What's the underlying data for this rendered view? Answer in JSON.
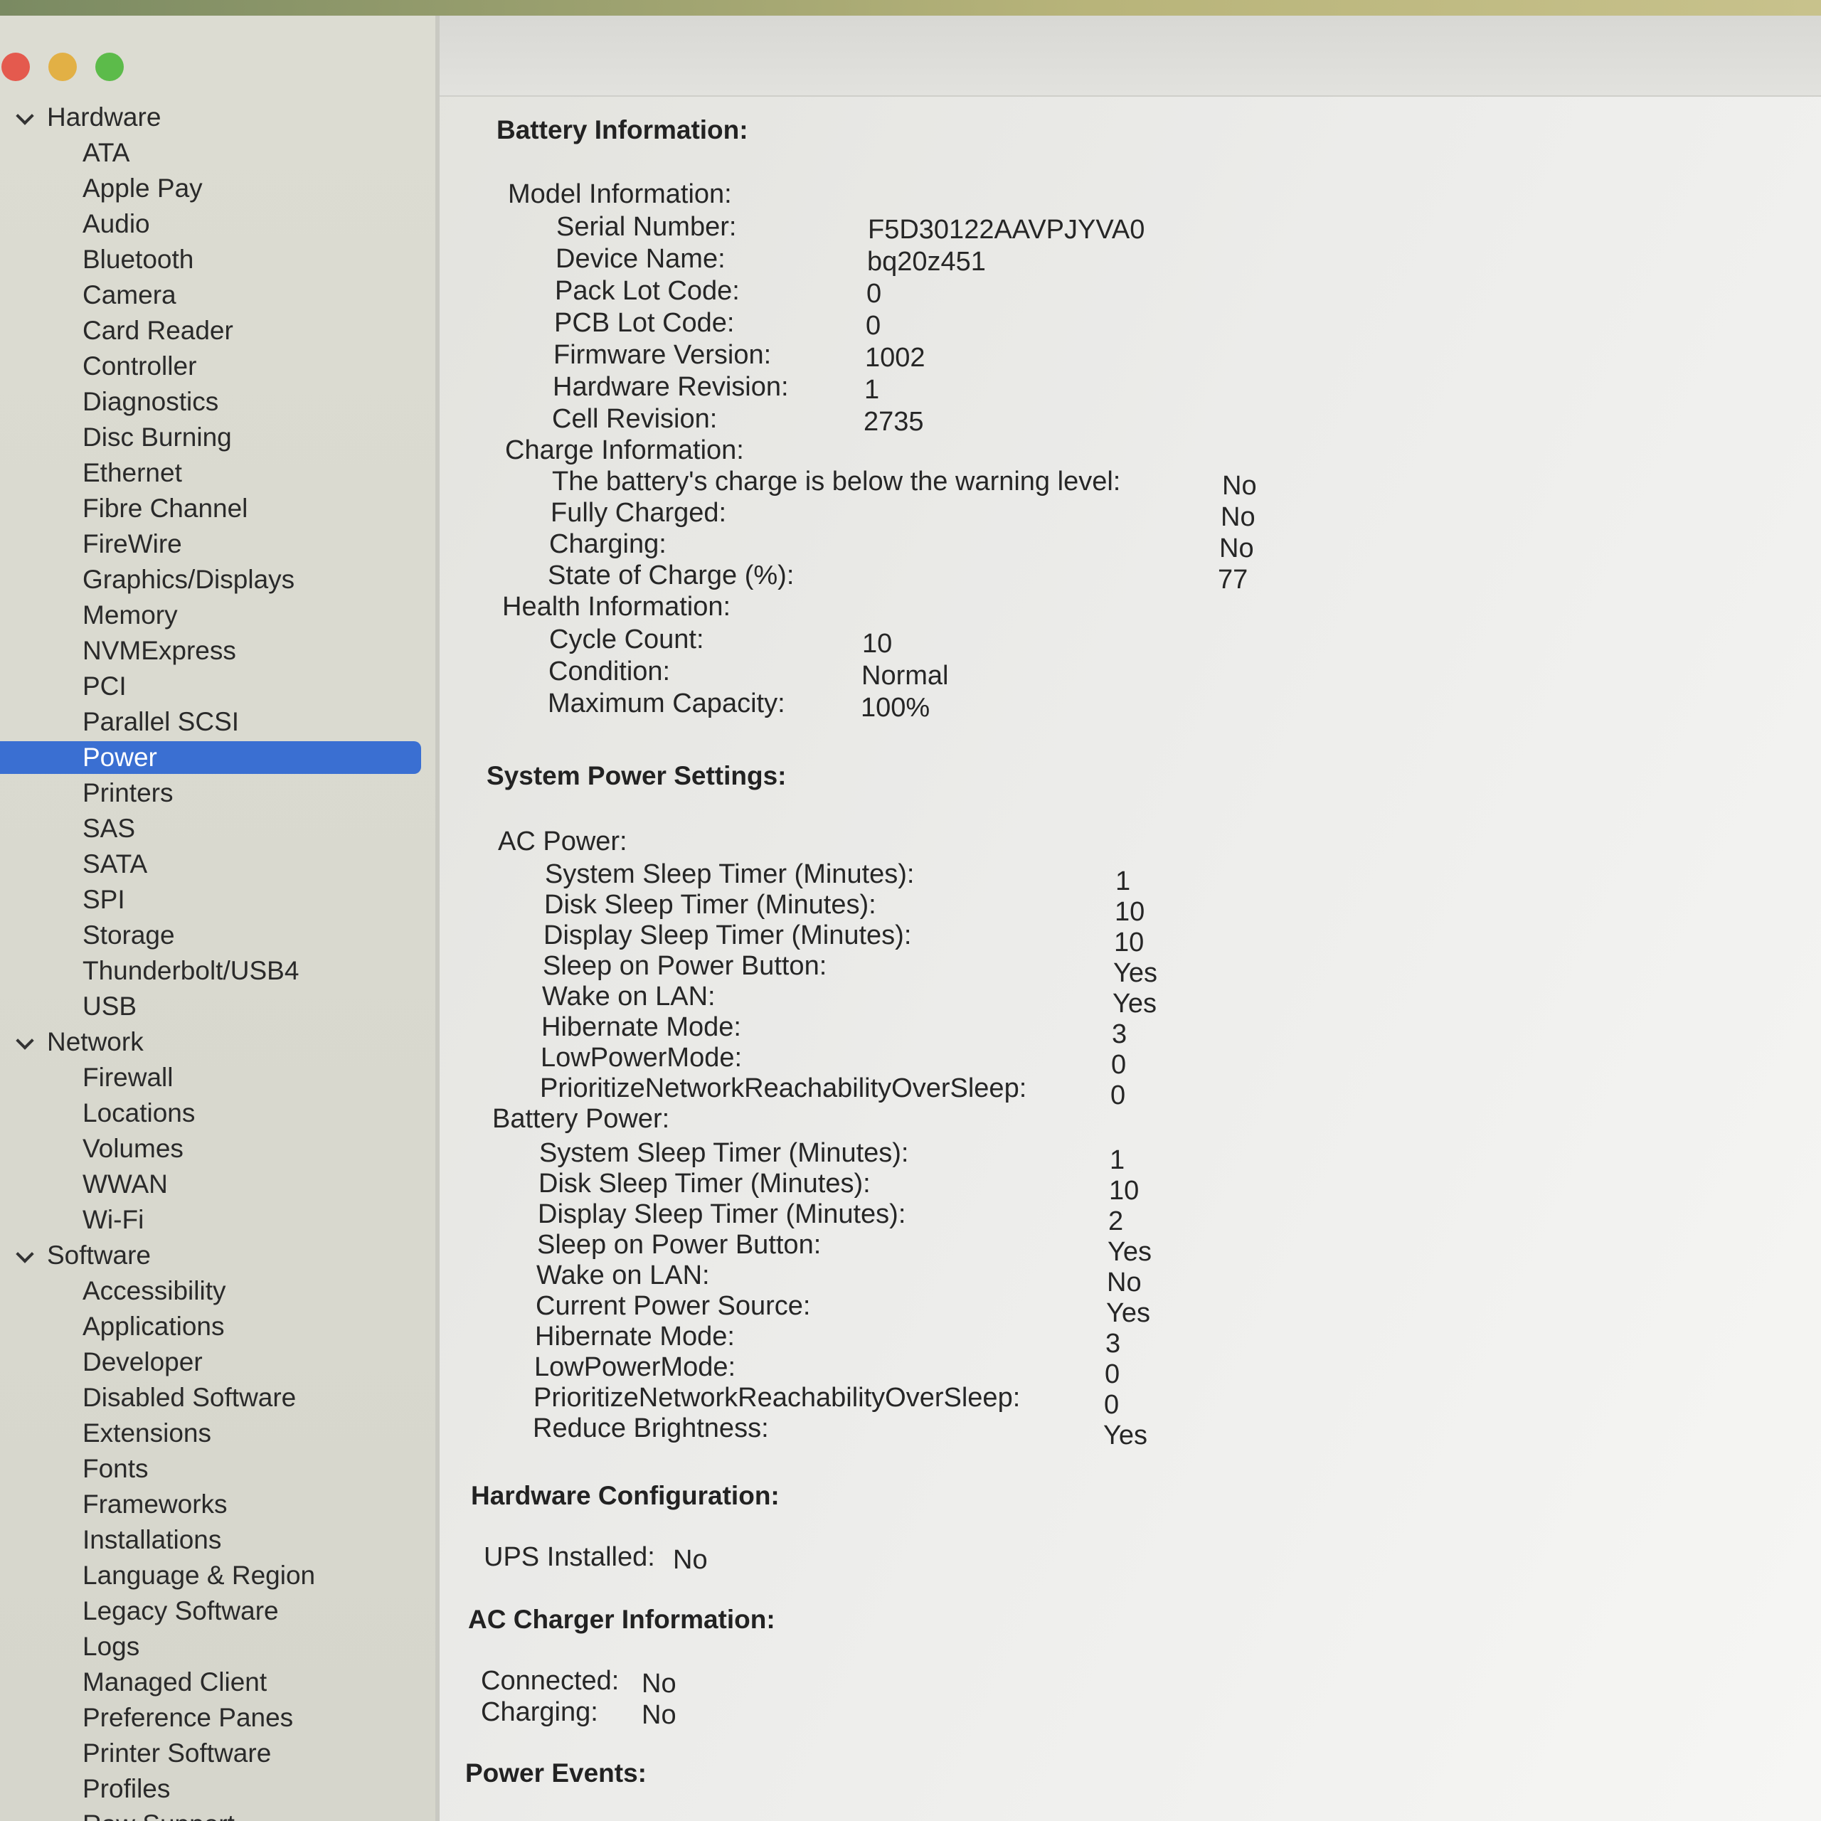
{
  "sidebar": {
    "items": [
      {
        "label": "Hardware",
        "type": "group"
      },
      {
        "label": "ATA",
        "type": "item"
      },
      {
        "label": "Apple Pay",
        "type": "item"
      },
      {
        "label": "Audio",
        "type": "item"
      },
      {
        "label": "Bluetooth",
        "type": "item"
      },
      {
        "label": "Camera",
        "type": "item"
      },
      {
        "label": "Card Reader",
        "type": "item"
      },
      {
        "label": "Controller",
        "type": "item"
      },
      {
        "label": "Diagnostics",
        "type": "item"
      },
      {
        "label": "Disc Burning",
        "type": "item"
      },
      {
        "label": "Ethernet",
        "type": "item"
      },
      {
        "label": "Fibre Channel",
        "type": "item"
      },
      {
        "label": "FireWire",
        "type": "item"
      },
      {
        "label": "Graphics/Displays",
        "type": "item"
      },
      {
        "label": "Memory",
        "type": "item"
      },
      {
        "label": "NVMExpress",
        "type": "item"
      },
      {
        "label": "PCI",
        "type": "item"
      },
      {
        "label": "Parallel SCSI",
        "type": "item"
      },
      {
        "label": "Power",
        "type": "item",
        "selected": true
      },
      {
        "label": "Printers",
        "type": "item"
      },
      {
        "label": "SAS",
        "type": "item"
      },
      {
        "label": "SATA",
        "type": "item"
      },
      {
        "label": "SPI",
        "type": "item"
      },
      {
        "label": "Storage",
        "type": "item"
      },
      {
        "label": "Thunderbolt/USB4",
        "type": "item"
      },
      {
        "label": "USB",
        "type": "item"
      },
      {
        "label": "Network",
        "type": "group"
      },
      {
        "label": "Firewall",
        "type": "item"
      },
      {
        "label": "Locations",
        "type": "item"
      },
      {
        "label": "Volumes",
        "type": "item"
      },
      {
        "label": "WWAN",
        "type": "item"
      },
      {
        "label": "Wi-Fi",
        "type": "item"
      },
      {
        "label": "Software",
        "type": "group"
      },
      {
        "label": "Accessibility",
        "type": "item"
      },
      {
        "label": "Applications",
        "type": "item"
      },
      {
        "label": "Developer",
        "type": "item"
      },
      {
        "label": "Disabled Software",
        "type": "item"
      },
      {
        "label": "Extensions",
        "type": "item"
      },
      {
        "label": "Fonts",
        "type": "item"
      },
      {
        "label": "Frameworks",
        "type": "item"
      },
      {
        "label": "Installations",
        "type": "item"
      },
      {
        "label": "Language & Region",
        "type": "item"
      },
      {
        "label": "Legacy Software",
        "type": "item"
      },
      {
        "label": "Logs",
        "type": "item"
      },
      {
        "label": "Managed Client",
        "type": "item"
      },
      {
        "label": "Preference Panes",
        "type": "item"
      },
      {
        "label": "Printer Software",
        "type": "item"
      },
      {
        "label": "Profiles",
        "type": "item"
      },
      {
        "label": "Raw Support",
        "type": "item"
      }
    ]
  },
  "battery": {
    "title": "Battery Information:",
    "model_header": "Model Information:",
    "model": [
      {
        "label": "Serial Number:",
        "value": "F5D30122AAVPJYVA0"
      },
      {
        "label": "Device Name:",
        "value": "bq20z451"
      },
      {
        "label": "Pack Lot Code:",
        "value": "0"
      },
      {
        "label": "PCB Lot Code:",
        "value": "0"
      },
      {
        "label": "Firmware Version:",
        "value": "1002"
      },
      {
        "label": "Hardware Revision:",
        "value": "1"
      },
      {
        "label": "Cell Revision:",
        "value": "2735"
      }
    ],
    "charge_header": "Charge Information:",
    "charge": [
      {
        "label": "The battery's charge is below the warning level:",
        "value": "No"
      },
      {
        "label": "Fully Charged:",
        "value": "No"
      },
      {
        "label": "Charging:",
        "value": "No"
      },
      {
        "label": "State of Charge (%):",
        "value": "77"
      }
    ],
    "health_header": "Health Information:",
    "health": [
      {
        "label": "Cycle Count:",
        "value": "10"
      },
      {
        "label": "Condition:",
        "value": "Normal"
      },
      {
        "label": "Maximum Capacity:",
        "value": "100%"
      }
    ]
  },
  "power_settings": {
    "title": "System Power Settings:",
    "ac_header": "AC Power:",
    "ac": [
      {
        "label": "System Sleep Timer (Minutes):",
        "value": "1"
      },
      {
        "label": "Disk Sleep Timer (Minutes):",
        "value": "10"
      },
      {
        "label": "Display Sleep Timer (Minutes):",
        "value": "10"
      },
      {
        "label": "Sleep on Power Button:",
        "value": "Yes"
      },
      {
        "label": "Wake on LAN:",
        "value": "Yes"
      },
      {
        "label": "Hibernate Mode:",
        "value": "3"
      },
      {
        "label": "LowPowerMode:",
        "value": "0"
      },
      {
        "label": "PrioritizeNetworkReachabilityOverSleep:",
        "value": "0"
      }
    ],
    "battery_header": "Battery Power:",
    "battery": [
      {
        "label": "System Sleep Timer (Minutes):",
        "value": "1"
      },
      {
        "label": "Disk Sleep Timer (Minutes):",
        "value": "10"
      },
      {
        "label": "Display Sleep Timer (Minutes):",
        "value": "2"
      },
      {
        "label": "Sleep on Power Button:",
        "value": "Yes"
      },
      {
        "label": "Wake on LAN:",
        "value": "No"
      },
      {
        "label": "Current Power Source:",
        "value": "Yes"
      },
      {
        "label": "Hibernate Mode:",
        "value": "3"
      },
      {
        "label": "LowPowerMode:",
        "value": "0"
      },
      {
        "label": "PrioritizeNetworkReachabilityOverSleep:",
        "value": "0"
      },
      {
        "label": "Reduce Brightness:",
        "value": "Yes"
      }
    ]
  },
  "hardware_config": {
    "title": "Hardware Configuration:",
    "ups_label": "UPS Installed:",
    "ups_value": "No"
  },
  "ac_charger": {
    "title": "AC Charger Information:",
    "connected_label": "Connected:",
    "connected_value": "No",
    "charging_label": "Charging:",
    "charging_value": "No"
  },
  "power_events": {
    "title": "Power Events:"
  },
  "colors": {
    "selection": "#3a6fd2",
    "close": "#e45a4e",
    "minimize": "#e2b045",
    "zoom": "#5cbb4a"
  }
}
